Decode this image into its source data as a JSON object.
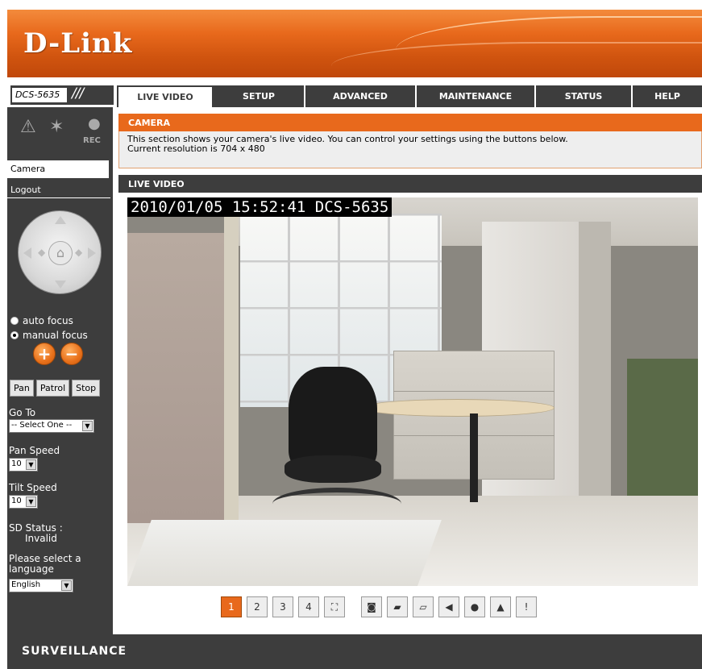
{
  "brand": {
    "logo": "D-Link",
    "accent": "#e8691c",
    "dark": "#3d3d3d"
  },
  "nav": {
    "model": "DCS-5635",
    "model_slash": "///",
    "tabs": [
      {
        "label": "LIVE VIDEO",
        "active": true
      },
      {
        "label": "SETUP"
      },
      {
        "label": "ADVANCED"
      },
      {
        "label": "MAINTENANCE"
      },
      {
        "label": "STATUS"
      },
      {
        "label": "HELP"
      }
    ]
  },
  "sidebar": {
    "status_icons": [
      "alarm-icon",
      "motion-icon",
      "record-icon"
    ],
    "rec_label": "REC",
    "links": [
      {
        "label": "Camera",
        "active": true
      },
      {
        "label": "Logout"
      }
    ],
    "focus": {
      "auto_label": "auto focus",
      "manual_label": "manual focus",
      "selected": "manual"
    },
    "zoom_in": "+",
    "zoom_out": "−",
    "buttons": [
      "Pan",
      "Patrol",
      "Stop"
    ],
    "goto_label": "Go To",
    "goto_value": "-- Select One --",
    "pan_speed_label": "Pan Speed",
    "pan_speed_value": "10",
    "tilt_speed_label": "Tilt Speed",
    "tilt_speed_value": "10",
    "sd_status_label": "SD Status :",
    "sd_status_value": "Invalid",
    "language_label": "Please select a language",
    "language_value": "English"
  },
  "main": {
    "camera_title": "CAMERA",
    "camera_desc": "This section shows your camera's live video. You can control your settings using the buttons below.",
    "resolution_text": "Current resolution is 704 x 480",
    "live_title": "LIVE VIDEO",
    "overlay": "2010/01/05 15:52:41 DCS-5635",
    "toolbar": [
      {
        "icon": "profile-1-icon",
        "glyph": "1",
        "active": true
      },
      {
        "icon": "profile-2-icon",
        "glyph": "2"
      },
      {
        "icon": "profile-3-icon",
        "glyph": "3"
      },
      {
        "icon": "profile-4-icon",
        "glyph": "4"
      },
      {
        "icon": "fullscreen-icon",
        "glyph": "⛶"
      },
      {
        "icon": "snapshot-icon",
        "glyph": "◙"
      },
      {
        "icon": "record-video-icon",
        "glyph": "▰"
      },
      {
        "icon": "folder-icon",
        "glyph": "▱"
      },
      {
        "icon": "speaker-icon",
        "glyph": "◀"
      },
      {
        "icon": "microphone-icon",
        "glyph": "●"
      },
      {
        "icon": "digital-output-icon",
        "glyph": "▲"
      },
      {
        "icon": "digital-input-icon",
        "glyph": "!"
      }
    ]
  },
  "footer": {
    "label": "SURVEILLANCE"
  }
}
